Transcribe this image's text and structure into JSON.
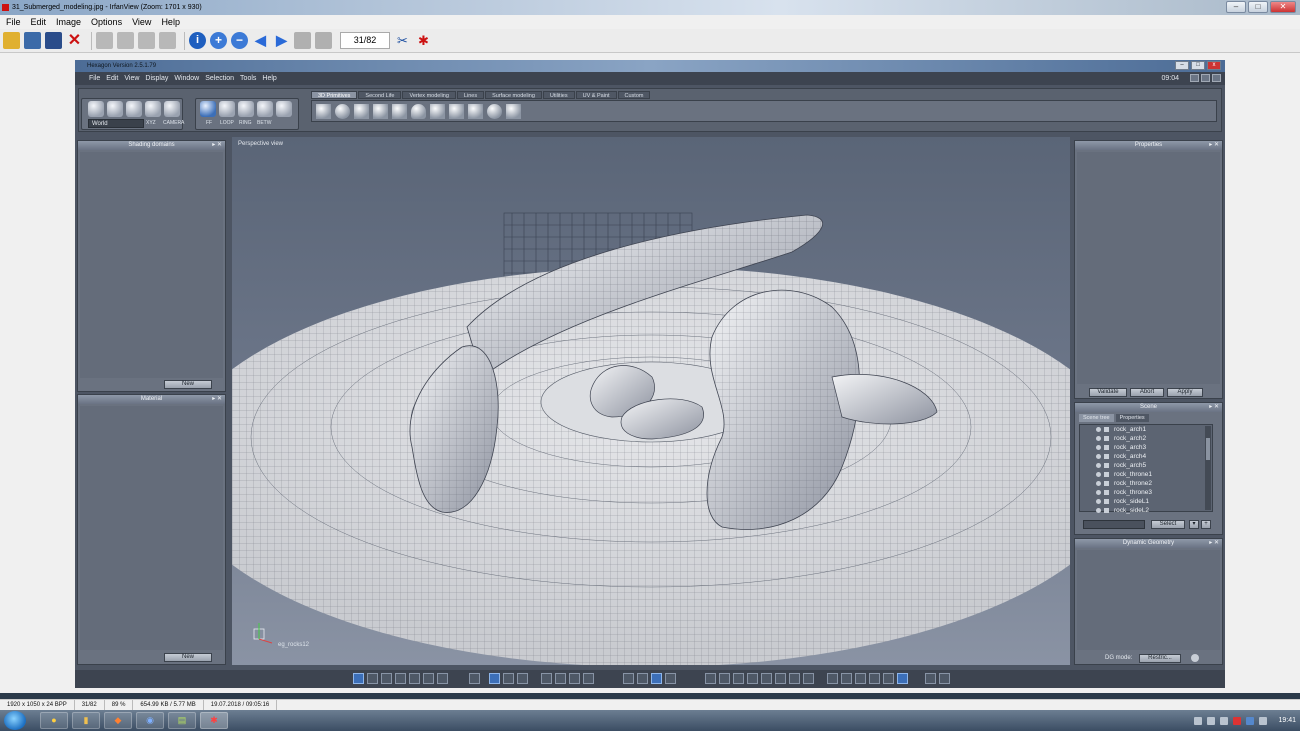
{
  "irfanview": {
    "title": "31_Submerged_modeling.jpg - IrfanView (Zoom: 1701 x 930)",
    "menu": [
      "File",
      "Edit",
      "Image",
      "Options",
      "View",
      "Help"
    ],
    "counter": "31/82",
    "status": {
      "dims": "1920 x 1050 x 24 BPP",
      "index": "31/82",
      "zoom": "89 %",
      "size": "654.99 KB / 5.77 MB",
      "date": "19.07.2018 / 09:05:16"
    }
  },
  "hexagon": {
    "title": "Hexagon Version 2.5.1.79",
    "menu": [
      "File",
      "Edit",
      "View",
      "Display",
      "Window",
      "Selection",
      "Tools",
      "Help"
    ],
    "clock": "09:04",
    "world_select": "World",
    "tool_labels": {
      "xyz": "XYZ",
      "camera": "CAMERA",
      "ff": "FF",
      "loop": "LOOP",
      "ring": "RING",
      "betw": "BETW"
    },
    "tabs": [
      "3D Primitives",
      "Second Life",
      "Vertex modeling",
      "Lines",
      "Surface modeling",
      "Utilities",
      "UV & Paint",
      "Custom"
    ],
    "panels": {
      "shading": {
        "title": "Shading domains",
        "button": "New"
      },
      "material": {
        "title": "Material",
        "button": "New"
      },
      "properties": {
        "title": "Properties",
        "buttons": [
          "Validate",
          "Abort",
          "Apply"
        ]
      },
      "scene": {
        "title": "Scene",
        "tabs": [
          "Scene tree",
          "Properties"
        ],
        "items": [
          "rock_arch1",
          "rock_arch2",
          "rock_arch3",
          "rock_arch4",
          "rock_arch5",
          "rock_throne1",
          "rock_throne2",
          "rock_throne3",
          "rock_sideL1",
          "rock_sideL2"
        ],
        "select_button": "Select"
      },
      "dynamic_geometry": {
        "title": "Dynamic Geometry",
        "dg_mode_label": "DG mode:",
        "dg_mode_value": "Restric..."
      }
    },
    "viewport": {
      "label": "Perspective view",
      "object": "eg_rocks12"
    }
  },
  "taskbar": {
    "clock": "19:41"
  },
  "colors": {
    "hex_bg": "#4d5563",
    "panel": "#6a7280",
    "accent_blue": "#3c6fb8",
    "mesh_light": "#e4e6ea"
  }
}
